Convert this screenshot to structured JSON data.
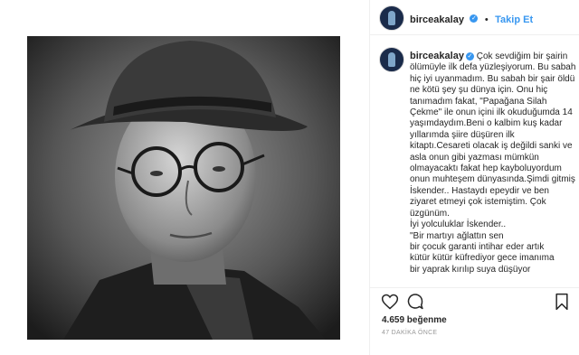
{
  "post": {
    "username": "birceakalay",
    "follow_label": "Takip Et",
    "separator": "•",
    "caption": "Çok sevdiğim bir şairin ölümüyle ilk defa yüzleşiyorum. Bu sabah hiç iyi uyanmadım. Bu sabah bir şair öldü ne kötü şey şu dünya için. Onu hiç tanımadım fakat, \"Papağana Silah Çekme\" ile onun içini ilk okuduğumda 14 yaşımdaydım.Beni o kalbim kuş kadar yıllarımda şiire düşüren ilk kitaptı.Cesareti olacak iş değildi sanki ve asla onun gibi yazması mümkün olmayacaktı fakat hep kayboluyordum onun muhteşem dünyasında.Şimdi gitmiş İskender.. Hastaydı epeydir ve ben ziyaret etmeyi çok istemiştim. Çok üzgünüm.\nİyi yolculuklar İskender..\n\"Bir martıyı ağlattın sen\nbir çocuk garanti intihar eder artık\nkütür kütür küfrediyor gece imanıma\nbir yaprak kırılıp suya düşüyor",
    "likes": "4.659 beğenme",
    "time_ago": "47 DAKİKA ÖNCE",
    "accent_color": "#3897f0",
    "icons": [
      "heart-icon",
      "comment-icon",
      "bookmark-icon",
      "verified-icon"
    ]
  }
}
